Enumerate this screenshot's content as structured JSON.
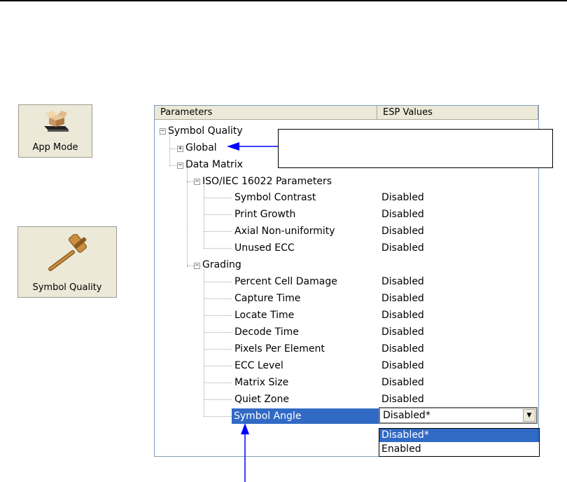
{
  "toolbar": {
    "app_mode": {
      "label": "App Mode",
      "icon": "box-on-tray-icon"
    },
    "symbol_quality": {
      "label": "Symbol Quality",
      "icon": "gavel-icon"
    }
  },
  "table": {
    "headers": [
      "Parameters",
      "ESP Values"
    ],
    "rows": [
      {
        "label": "Symbol Quality",
        "value": ""
      },
      {
        "label": "Global",
        "value": ""
      },
      {
        "label": "Data Matrix",
        "value": ""
      },
      {
        "label": "ISO/IEC 16022 Parameters",
        "value": ""
      },
      {
        "label": "Symbol Contrast",
        "value": "Disabled"
      },
      {
        "label": "Print Growth",
        "value": "Disabled"
      },
      {
        "label": "Axial Non-uniformity",
        "value": "Disabled"
      },
      {
        "label": "Unused ECC",
        "value": "Disabled"
      },
      {
        "label": "Grading",
        "value": ""
      },
      {
        "label": "Percent Cell Damage",
        "value": "Disabled"
      },
      {
        "label": "Capture Time",
        "value": "Disabled"
      },
      {
        "label": "Locate Time",
        "value": "Disabled"
      },
      {
        "label": "Decode Time",
        "value": "Disabled"
      },
      {
        "label": "Pixels Per Element",
        "value": "Disabled"
      },
      {
        "label": "ECC Level",
        "value": "Disabled"
      },
      {
        "label": "Matrix Size",
        "value": "Disabled"
      },
      {
        "label": "Quiet Zone",
        "value": "Disabled"
      },
      {
        "label": "Symbol Angle",
        "value": "Disabled*"
      }
    ]
  },
  "dropdown": {
    "current": "Disabled*",
    "options": [
      "Disabled*",
      "Enabled"
    ],
    "highlighted": "Disabled*"
  },
  "colors": {
    "selection": "#316ac5",
    "arrow": "#0000ff",
    "header_bg": "#ece9d8"
  }
}
